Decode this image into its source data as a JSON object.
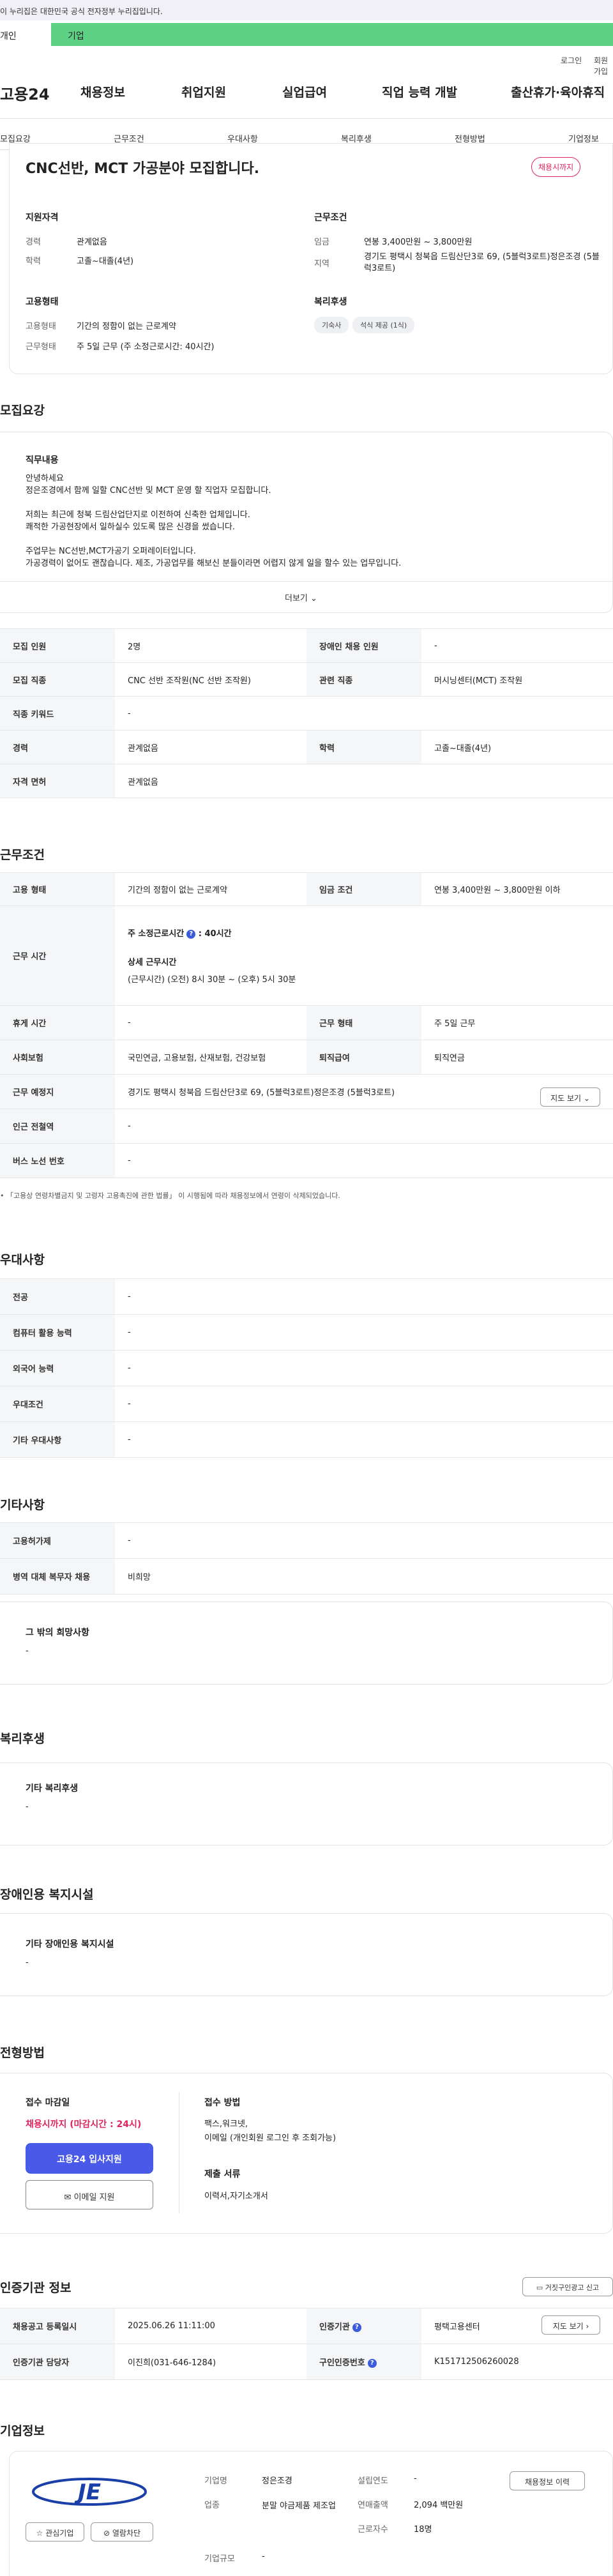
{
  "gov_banner": "이 누리집은 대한민국 공식 전자정부 누리집입니다.",
  "tabs": {
    "individual": "개인",
    "business": "기업"
  },
  "util": {
    "login": "로그인",
    "join": "회원가입"
  },
  "logo": "고용24",
  "gnb": [
    "채용정보",
    "취업지원",
    "실업급여",
    "직업 능력 개발",
    "출산휴가·육아휴직"
  ],
  "subnav": [
    "모집요강",
    "근무조건",
    "우대사항",
    "복리후생",
    "전형방법",
    "기업정보"
  ],
  "summary": {
    "title": "CNC선반, MCT 가공분야 모집합니다.",
    "status_badge": "채용시까지",
    "qual_title": "지원자격",
    "exp_label": "경력",
    "exp_value": "관계없음",
    "edu_label": "학력",
    "edu_value": "고졸~대졸(4년)",
    "cond_title": "근무조건",
    "wage_label": "임금",
    "wage_value": "연봉 3,400만원 ~ 3,800만원",
    "region_label": "지역",
    "region_value": "경기도 평택시 청북읍 드림산단3로 69, (5블럭3로트)정은조경 (5블럭3로트)",
    "emp_title": "고용형태",
    "emptype_label": "고용형태",
    "emptype_value": "기간의 정함이 없는 근로계약",
    "workform_label": "근무형태",
    "workform_value": "주 5일 근무 (주 소정근로시간: 40시간)",
    "welfare_title": "복리후생",
    "welfare_chips": [
      "기숙사",
      "석식 제공 (1식)"
    ]
  },
  "recruit": {
    "section_title": "모집요강",
    "duty_title": "직무내용",
    "duty_lines": [
      "안녕하세요",
      "정은조경에서 함께 일할 CNC선반 및 MCT 운영 할  직업자 모집합니다.",
      "",
      "저희는 최근에 청북 드림산업단지로 이전하여 신축한 업체입니다.",
      "쾌적한 가공현장에서 일하실수 있도록 많은 신경을 썼습니다.",
      "",
      "주업무는 NC선반,MCT가공기 오퍼레이터입니다.",
      "가공경력이 없어도 괜찮습니다. 제조, 가공업무를 해보신 분들이라면 어렵지 않게 일을 할수 있는 업무입니다."
    ],
    "more": "더보기",
    "table": [
      [
        "모집 인원",
        "2명",
        "장애인 채용 인원",
        "-"
      ],
      [
        "모집 직종",
        "CNC 선반 조작원(NC 선반 조작원)",
        "관련 직종",
        "머시닝센터(MCT) 조작원"
      ],
      [
        "직종 키워드",
        "-"
      ],
      [
        "경력",
        "관계없음",
        "학력",
        "고졸~대졸(4년)"
      ],
      [
        "자격 면허",
        "관계없음"
      ]
    ]
  },
  "conditions": {
    "section_title": "근무조건",
    "emptype_label": "고용 형태",
    "emptype_value": "기간의 정함이 없는 근로계약",
    "wage_label": "임금 조건",
    "wage_value": "연봉 3,400만원 ~ 3,800만원 이하",
    "worktime_label": "근무 시간",
    "weekly_hours": "주 소정근로시간",
    "weekly_hours_value": ": 40시간",
    "detail_label": "상세 근무시간",
    "detail_value": "(근무시간) (오전) 8시 30분 ~ (오후) 5시 30분",
    "break_label": "휴게 시간",
    "break_value": "-",
    "workform_label": "근무 형태",
    "workform_value": "주 5일 근무",
    "insurance_label": "사회보험",
    "insurance_value": "국민연금, 고용보험, 산재보험, 건강보험",
    "severance_label": "퇴직급여",
    "severance_value": "퇴직연금",
    "location_label": "근무 예정지",
    "location_value": "경기도 평택시 청북읍 드림산단3로 69, (5블럭3로트)정은조경 (5블럭3로트)",
    "map_button": "지도 보기",
    "subway_label": "인근 전철역",
    "subway_value": "-",
    "bus_label": "버스 노선 번호",
    "bus_value": "-",
    "note": "「고용상 연령차별금지 및 고령자 고용촉진에 관한 법률」 이 시행됨에 따라 채용정보에서 연령이 삭제되었습니다."
  },
  "preference": {
    "section_title": "우대사항",
    "rows": [
      [
        "전공",
        "-"
      ],
      [
        "컴퓨터 활용 능력",
        "-"
      ],
      [
        "외국어 능력",
        "-"
      ],
      [
        "우대조건",
        "-"
      ],
      [
        "기타 우대사항",
        "-"
      ]
    ]
  },
  "etc": {
    "section_title": "기타사항",
    "rows": [
      [
        "고용허가제",
        "-"
      ],
      [
        "병역 대체 복무자 채용",
        "비희망"
      ]
    ],
    "hope_title": "그 밖의 희망사항",
    "hope_value": "-"
  },
  "welfare": {
    "section_title": "복리후생",
    "box_title": "기타 복리후생",
    "box_value": "-"
  },
  "disability": {
    "section_title": "장애인용 복지시설",
    "box_title": "기타 장애인용 복지시설",
    "box_value": "-"
  },
  "selection": {
    "section_title": "전형방법",
    "deadline_title": "접수 마감일",
    "deadline_value": "채용시까지 (마감시간 : 24시)",
    "apply_button": "고용24 입사지원",
    "email_button": "이메일 지원",
    "method_title": "접수 방법",
    "method_lines": [
      "팩스,워크넷,",
      "이메일 (개인회원 로그인 후 조회가능)"
    ],
    "docs_title": "제출 서류",
    "docs_value": "이력서,자기소개서"
  },
  "cert": {
    "section_title": "인증기관 정보",
    "report_button": "거짓구인광고 신고",
    "posted_label": "채용공고 등록일시",
    "posted_value": "2025.06.26 11:11:00",
    "agency_label": "인증기관",
    "agency_value": "평택고용센터",
    "map_button": "지도 보기",
    "manager_label": "인증기관 담당자",
    "manager_value": "이진희(031-646-1284)",
    "reqno_label": "구인인증번호",
    "reqno_value": "K151712506260028"
  },
  "company": {
    "section_title": "기업정보",
    "logo_text": "JE",
    "interest_button": "관심기업",
    "block_button": "열람차단",
    "name_label": "기업명",
    "name_value": "정은조경",
    "industry_label": "업종",
    "industry_value": "분말 야금제품 제조업",
    "scale_label": "기업규모",
    "scale_value": "-",
    "founded_label": "설립연도",
    "founded_value": "-",
    "sales_label": "연매출액",
    "sales_value": "2,094 백만원",
    "employees_label": "근로자수",
    "employees_value": "18명",
    "jobs_button": "채용정보 이력"
  },
  "colors": {
    "accent_green": "#5fd185",
    "primary_blue": "#4a5ae8",
    "deadline_red": "#e0245e"
  }
}
